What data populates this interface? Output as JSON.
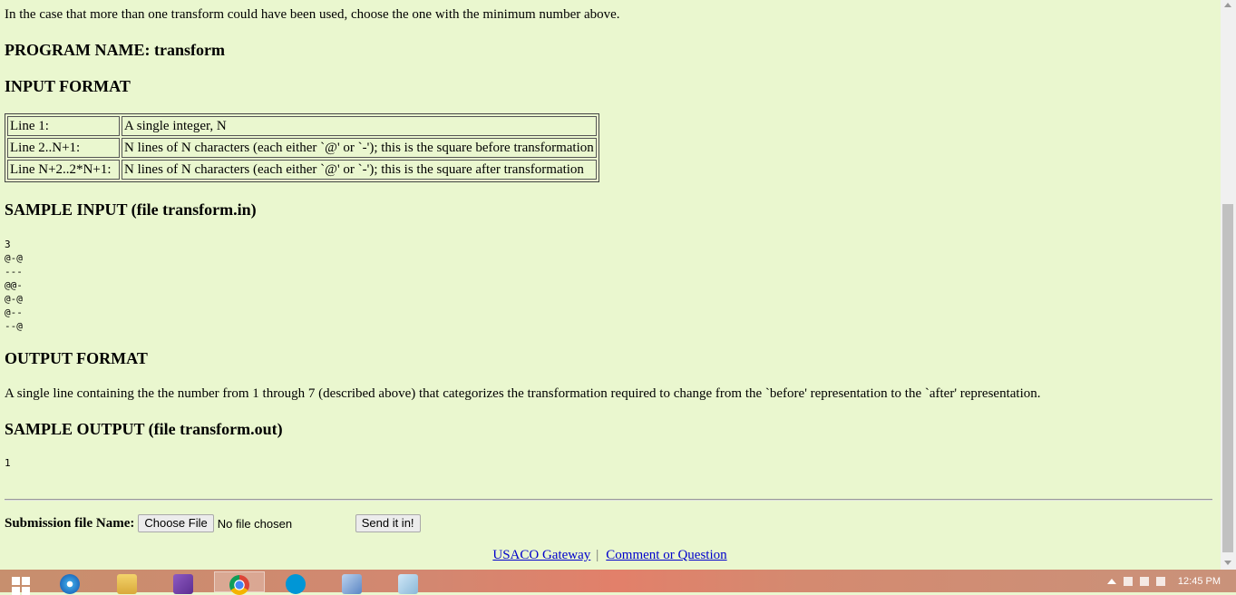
{
  "intro_text": "In the case that more than one transform could have been used, choose the one with the minimum number above.",
  "headings": {
    "program": "PROGRAM NAME: transform",
    "input_format": "INPUT FORMAT",
    "sample_input": "SAMPLE INPUT (file transform.in)",
    "output_format": "OUTPUT FORMAT",
    "sample_output": "SAMPLE OUTPUT (file transform.out)"
  },
  "input_table": [
    {
      "line": "Line 1:",
      "desc": "A single integer, N"
    },
    {
      "line": "Line 2..N+1:",
      "desc": "N lines of N characters (each either `@' or `-'); this is the square before transformation"
    },
    {
      "line": "Line N+2..2*N+1:",
      "desc": "N lines of N characters (each either `@' or `-'); this is the square after transformation"
    }
  ],
  "sample_input": "3\n@-@\n---\n@@-\n@-@\n@--\n--@",
  "output_description": "A single line containing the the number from 1 through 7 (described above) that categorizes the transformation required to change from the `before' representation to the `after' representation.",
  "sample_output": "1",
  "submission": {
    "label": "Submission file Name:",
    "choose_file_label": "Choose File",
    "no_file_text": "No file chosen",
    "send_label": "Send it in!"
  },
  "footer": {
    "gateway_link": "USACO Gateway",
    "separator": "|",
    "comment_link": "Comment or Question"
  },
  "taskbar": {
    "time": "12:45 PM",
    "apps": [
      "start-icon",
      "internet-explorer-icon",
      "file-explorer-icon",
      "visual-studio-icon",
      "chrome-icon",
      "hp-icon",
      "virtualbox-icon",
      "notepad-icon"
    ]
  },
  "colors": {
    "page_background": "#eaf7cf",
    "link": "#0000cc"
  }
}
